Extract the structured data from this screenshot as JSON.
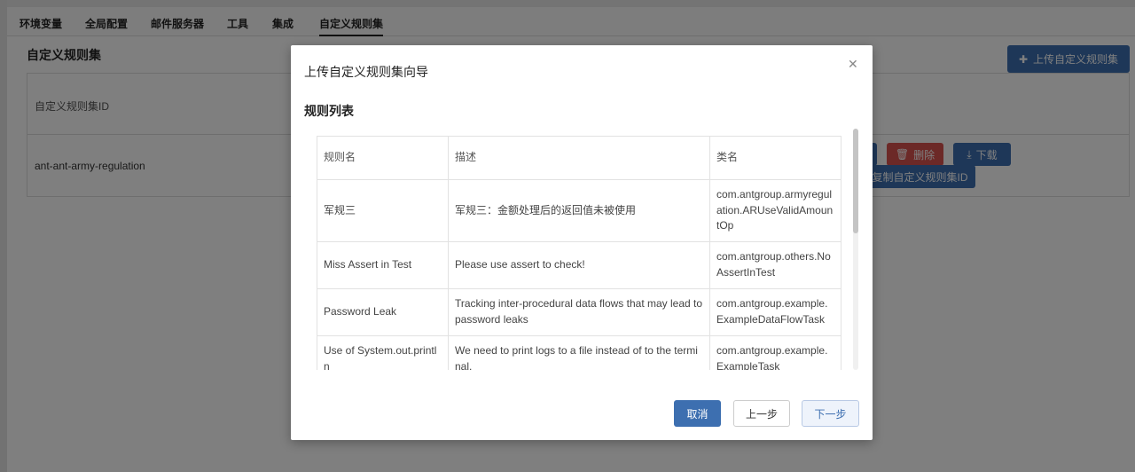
{
  "tabs": [
    "环境变量",
    "全局配置",
    "邮件服务器",
    "工具",
    "集成",
    "自定义规则集"
  ],
  "section": {
    "title": "自定义规则集",
    "upload_label": "上传自定义规则集"
  },
  "bg_table": {
    "header_id": "自定义规则集ID",
    "row_id": "ant-ant-army-regulation",
    "delete_label": "删除",
    "download_label": "下载",
    "copy_label": "复制自定义规则集ID"
  },
  "modal": {
    "title": "上传自定义规则集向导",
    "list_title": "规则列表",
    "columns": [
      "规则名",
      "描述",
      "类名"
    ],
    "rows": [
      [
        "军规三",
        "军规三：金额处理后的返回值未被使用",
        "com.antgroup.armyregulation.ARUseValidAmountOp"
      ],
      [
        "Miss Assert in Test",
        "Please use assert to check!",
        "com.antgroup.others.NoAssertInTest"
      ],
      [
        "Password Leak",
        "Tracking inter-procedural data flows that may lead to password leaks",
        "com.antgroup.example.ExampleDataFlowTask"
      ],
      [
        "Use of System.out.println",
        "We need to print logs to a file instead of to the terminal.",
        "com.antgroup.example.ExampleTask"
      ]
    ],
    "cancel_label": "取消",
    "prev_label": "上一步",
    "next_label": "下一步"
  },
  "colors": {
    "primary": "#3d6fb0",
    "danger": "#d9534f"
  }
}
